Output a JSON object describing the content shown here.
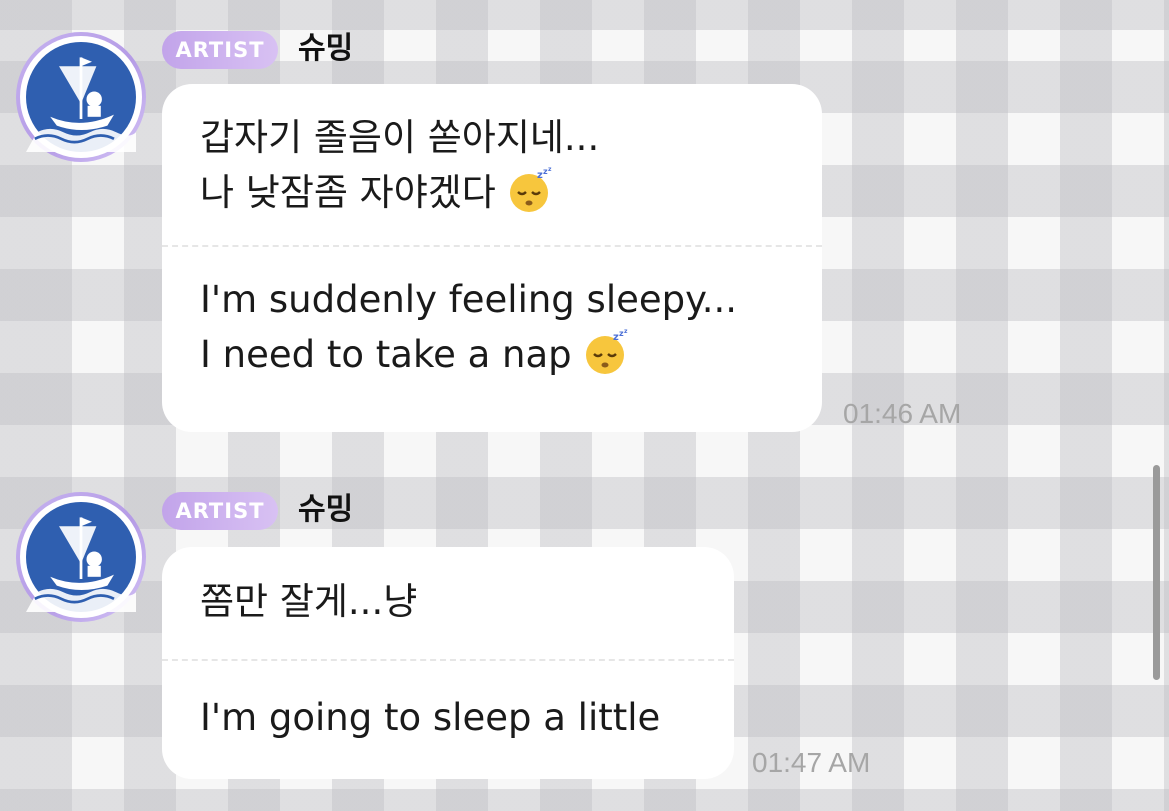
{
  "messages": [
    {
      "badge": "ARTIST",
      "username": "슈밍",
      "avatar_icon": "ship-sailor-avatar-icon",
      "korean_lines": [
        "갑자기 졸음이 쏟아지네...",
        "나 낮잠좀 자야겠다"
      ],
      "english_lines": [
        "I'm suddenly feeling sleepy...",
        "I need to take a nap"
      ],
      "emoji": "sleeping-face-icon",
      "time": "01:46 AM"
    },
    {
      "badge": "ARTIST",
      "username": "슈밍",
      "avatar_icon": "ship-sailor-avatar-icon",
      "korean_lines": [
        "쫌만 잘게...냥"
      ],
      "english_lines": [
        "I'm going to sleep a little"
      ],
      "time": "01:47 AM"
    }
  ],
  "colors": {
    "badge_gradient_start": "#c2a4ea",
    "badge_gradient_end": "#d8c1f3",
    "avatar_ring": "#b59be6",
    "avatar_blue": "#2f5fb0",
    "timestamp": "#a6a6a6"
  }
}
